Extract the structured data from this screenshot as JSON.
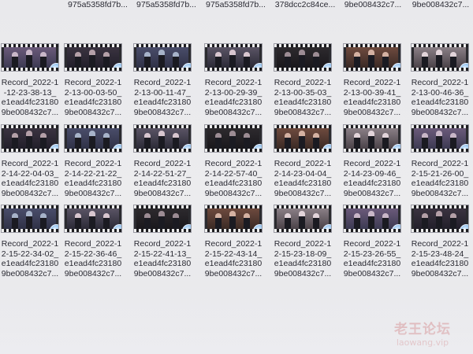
{
  "top_row": [
    "",
    "975a5358fd7b...",
    "975a5358fd7b...",
    "975a5358fd7b...",
    "378dcc2c84ce...",
    "9be008432c7...",
    "9be008432c7..."
  ],
  "rows": [
    [
      {
        "line1": "Record_2022-1",
        "line2": "-12-23-38-13_",
        "line3": "e1ead4fc23180",
        "line4": "9be008432c7..."
      },
      {
        "line1": "Record_2022-1",
        "line2": "2-13-00-03-50_",
        "line3": "e1ead4fc23180",
        "line4": "9be008432c7..."
      },
      {
        "line1": "Record_2022-1",
        "line2": "2-13-00-11-47_",
        "line3": "e1ead4fc23180",
        "line4": "9be008432c7..."
      },
      {
        "line1": "Record_2022-1",
        "line2": "2-13-00-29-39_",
        "line3": "e1ead4fc23180",
        "line4": "9be008432c7..."
      },
      {
        "line1": "Record_2022-1",
        "line2": "2-13-00-35-03_",
        "line3": "e1ead4fc23180",
        "line4": "9be008432c7..."
      },
      {
        "line1": "Record_2022-1",
        "line2": "2-13-00-39-41_",
        "line3": "e1ead4fc23180",
        "line4": "9be008432c7..."
      },
      {
        "line1": "Record_2022-1",
        "line2": "2-13-00-46-36_",
        "line3": "e1ead4fc23180",
        "line4": "9be008432c7..."
      }
    ],
    [
      {
        "line1": "Record_2022-1",
        "line2": "2-14-22-04-03_",
        "line3": "e1ead4fc23180",
        "line4": "9be008432c7..."
      },
      {
        "line1": "Record_2022-1",
        "line2": "2-14-22-21-22_",
        "line3": "e1ead4fc23180",
        "line4": "9be008432c7..."
      },
      {
        "line1": "Record_2022-1",
        "line2": "2-14-22-51-27_",
        "line3": "e1ead4fc23180",
        "line4": "9be008432c7..."
      },
      {
        "line1": "Record_2022-1",
        "line2": "2-14-22-57-40_",
        "line3": "e1ead4fc23180",
        "line4": "9be008432c7..."
      },
      {
        "line1": "Record_2022-1",
        "line2": "2-14-23-04-04_",
        "line3": "e1ead4fc23180",
        "line4": "9be008432c7..."
      },
      {
        "line1": "Record_2022-1",
        "line2": "2-14-23-09-46_",
        "line3": "e1ead4fc23180",
        "line4": "9be008432c7..."
      },
      {
        "line1": "Record_2022-1",
        "line2": "2-15-21-26-00_",
        "line3": "e1ead4fc23180",
        "line4": "9be008432c7..."
      }
    ],
    [
      {
        "line1": "Record_2022-1",
        "line2": "2-15-22-34-02_",
        "line3": "e1ead4fc23180",
        "line4": "9be008432c7..."
      },
      {
        "line1": "Record_2022-1",
        "line2": "2-15-22-36-46_",
        "line3": "e1ead4fc23180",
        "line4": "9be008432c7..."
      },
      {
        "line1": "Record_2022-1",
        "line2": "2-15-22-41-13_",
        "line3": "e1ead4fc23180",
        "line4": "9be008432c7..."
      },
      {
        "line1": "Record_2022-1",
        "line2": "2-15-22-43-14_",
        "line3": "e1ead4fc23180",
        "line4": "9be008432c7..."
      },
      {
        "line1": "Record_2022-1",
        "line2": "2-15-23-18-09_",
        "line3": "e1ead4fc23180",
        "line4": "9be008432c7..."
      },
      {
        "line1": "Record_2022-1",
        "line2": "2-15-23-26-55_",
        "line3": "e1ead4fc23180",
        "line4": "9be008432c7..."
      },
      {
        "line1": "Record_2022-1",
        "line2": "2-15-23-48-24_",
        "line3": "e1ead4fc23180",
        "line4": "9be008432c7..."
      }
    ]
  ],
  "watermark": {
    "cn": "老王论坛",
    "url": "laowang.vip"
  },
  "colors": {
    "background": "#ebebee",
    "text": "#2a2a33",
    "badge": "#5c9fe0",
    "watermark": "#d9a8aa"
  },
  "icons": {
    "video_thumbnail": "video-file-icon",
    "overlay": "media-player-badge-icon"
  }
}
